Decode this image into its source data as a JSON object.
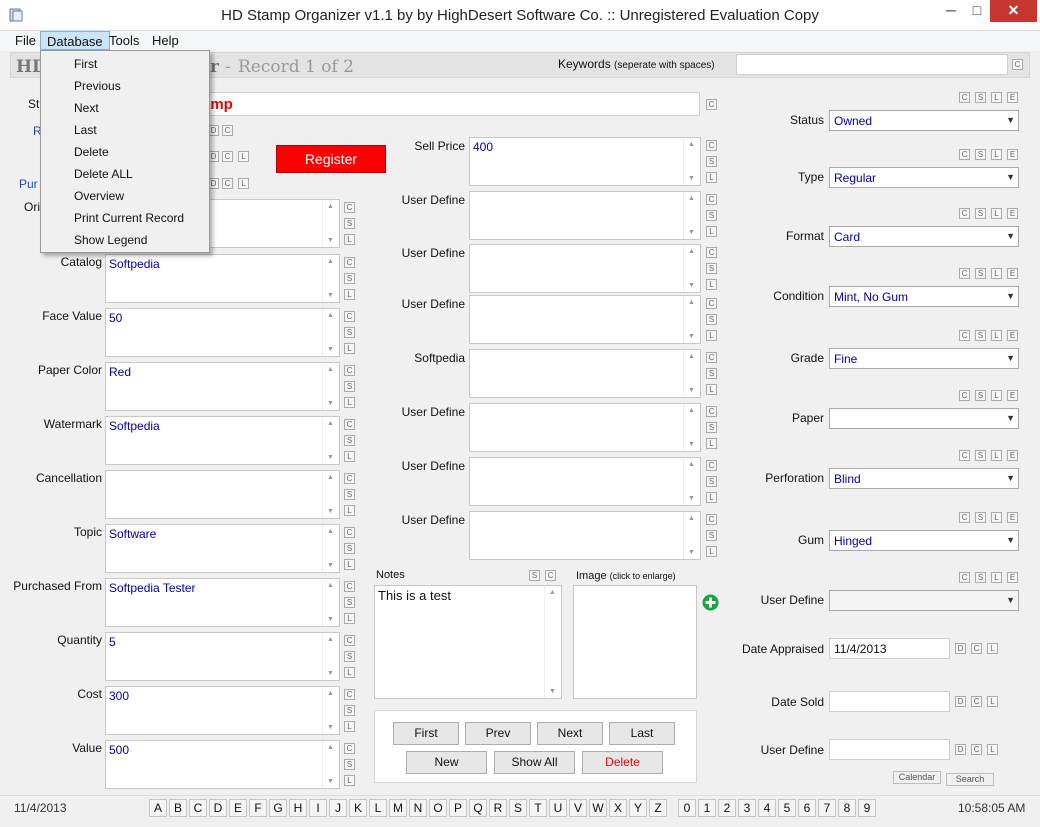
{
  "window": {
    "title": "HD Stamp Organizer v1.1 by by HighDesert Software Co. :: Unregistered Evaluation Copy",
    "min": "─",
    "max": "□",
    "close": "✕"
  },
  "menubar": [
    "File",
    "Database",
    "Tools",
    "Help"
  ],
  "database_menu": [
    "First",
    "Previous",
    "Next",
    "Last",
    "Delete",
    "Delete ALL",
    "Overview",
    "Print Current Record",
    "Show Legend"
  ],
  "header": {
    "app_partial": "HD",
    "app_partial_end": "r",
    "record": "Record 1 of 2",
    "record_sep": "-",
    "keywords_label": "Keywords",
    "keywords_hint": "(seperate with spaces)",
    "keywords_value": "",
    "c_button": "C"
  },
  "top_left": {
    "stamp_label_partial": "St",
    "stamp_title_partial": "amp",
    "r_partial": "R",
    "pur_partial": "Pur",
    "ori_partial": "Ori",
    "register": "Register"
  },
  "left_fields": [
    {
      "label": "Catalog",
      "value": "Softpedia"
    },
    {
      "label": "Face Value",
      "value": "50"
    },
    {
      "label": "Paper Color",
      "value": "Red"
    },
    {
      "label": "Watermark",
      "value": "Softpedia"
    },
    {
      "label": "Cancellation",
      "value": ""
    },
    {
      "label": "Topic",
      "value": "Software"
    },
    {
      "label": "Purchased From",
      "value": "Softpedia Tester"
    },
    {
      "label": "Quantity",
      "value": "5"
    },
    {
      "label": "Cost",
      "value": "300"
    },
    {
      "label": "Value",
      "value": "500"
    }
  ],
  "mid_fields": [
    {
      "label": "Sell Price",
      "value": "400"
    },
    {
      "label": "User Define",
      "value": ""
    },
    {
      "label": "User Define",
      "value": ""
    },
    {
      "label": "User Define",
      "value": ""
    },
    {
      "label": "Softpedia",
      "value": ""
    },
    {
      "label": "User Define",
      "value": ""
    },
    {
      "label": "User Define",
      "value": ""
    },
    {
      "label": "User Define",
      "value": ""
    }
  ],
  "side_letters": [
    "C",
    "S",
    "L"
  ],
  "notes": {
    "label": "Notes",
    "value": "This is a test",
    "s": "S",
    "c": "C"
  },
  "image": {
    "label": "Image",
    "hint": "(click to enlarge)"
  },
  "nav": {
    "first": "First",
    "prev": "Prev",
    "next": "Next",
    "last": "Last",
    "new": "New",
    "show_all": "Show All",
    "delete": "Delete"
  },
  "right_fields": [
    {
      "label": "Status",
      "value": "Owned"
    },
    {
      "label": "Type",
      "value": "Regular"
    },
    {
      "label": "Format",
      "value": "Card"
    },
    {
      "label": "Condition",
      "value": "Mint, No Gum"
    },
    {
      "label": "Grade",
      "value": "Fine"
    },
    {
      "label": "Paper",
      "value": ""
    },
    {
      "label": "Perforation",
      "value": "Blind"
    },
    {
      "label": "Gum",
      "value": "Hinged"
    },
    {
      "label": "User Define",
      "value": ""
    }
  ],
  "csle": [
    "C",
    "S",
    "L",
    "E"
  ],
  "dates": [
    {
      "label": "Date Appraised",
      "value": "11/4/2013"
    },
    {
      "label": "Date Sold",
      "value": ""
    },
    {
      "label": "User Define",
      "value": ""
    }
  ],
  "dcl": [
    "D",
    "C",
    "L"
  ],
  "calendar": "Calendar",
  "search": "Search",
  "statusbar": {
    "date": "11/4/2013",
    "time": "10:58:05 AM"
  },
  "alpha": [
    "A",
    "B",
    "C",
    "D",
    "E",
    "F",
    "G",
    "H",
    "I",
    "J",
    "K",
    "L",
    "M",
    "N",
    "O",
    "P",
    "Q",
    "R",
    "S",
    "T",
    "U",
    "V",
    "W",
    "X",
    "Y",
    "Z"
  ],
  "digits": [
    "0",
    "1",
    "2",
    "3",
    "4",
    "5",
    "6",
    "7",
    "8",
    "9"
  ]
}
